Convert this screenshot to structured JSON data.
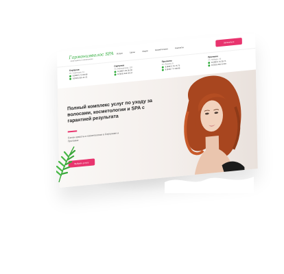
{
  "logo": {
    "text": "Гармонияволос SPA",
    "sub": "салон красоты и косметологии"
  },
  "nav": {
    "items": [
      "Услуги",
      "Цены",
      "Акции",
      "Косметология",
      "Контакты"
    ]
  },
  "header": {
    "cta": "Записаться"
  },
  "contacts": [
    {
      "city": "Серпухов",
      "addr": "Ул. Советская, 11",
      "phones": [
        "8 (4967) 72-08-08",
        "8 (916) 555-11-22"
      ]
    },
    {
      "city": "Серпухов",
      "addr": "Ул. Ворошилова, 120",
      "phones": [
        "8 (4967) 35-35-00",
        "8 (916) 444-33-22"
      ]
    },
    {
      "city": "Протвино",
      "addr": "Ул. Ленина, 6",
      "phones": [
        "8 (4967) 74-75-75",
        "8 (916) 777-88-99"
      ]
    },
    {
      "city": "Протвино",
      "addr": "Ул. Победы, 15",
      "phones": [
        "8 (4967) 31-28-71",
        "8 (916) 481-14-60"
      ]
    }
  ],
  "hero": {
    "title": "Полный комплекс услуг по уходу за волосами, косметологии и SPA с гарантией результата",
    "subtitle": "Салон красоты и косметологии в Серпухове и Протвино",
    "cta": "Выбрать услугу"
  },
  "colors": {
    "accent": "#e8346e",
    "brand": "#2eaa3a"
  }
}
